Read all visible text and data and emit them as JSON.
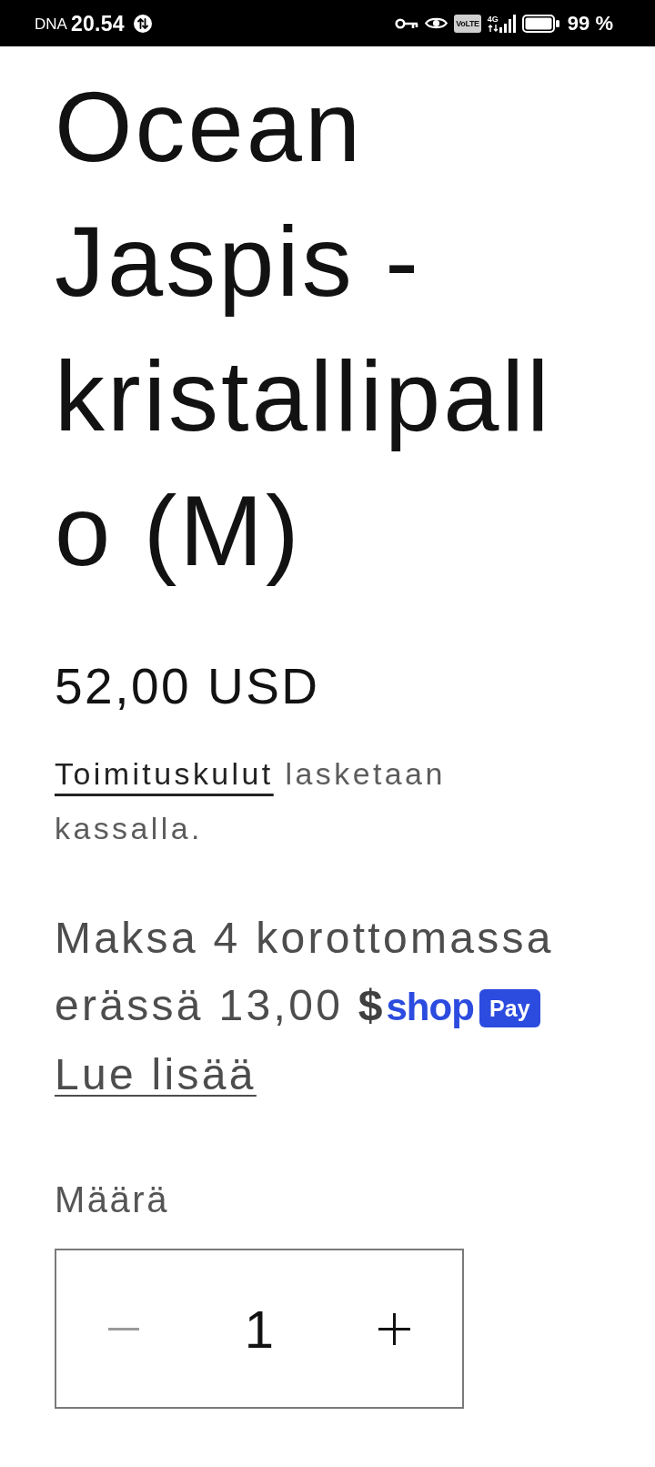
{
  "status_bar": {
    "carrier": "DNA",
    "time": "20.54",
    "volte": "VoLTE",
    "network": "4G",
    "battery": "99 %"
  },
  "product": {
    "title": "Ocean Jaspis - kristallipallo (M)",
    "price": "52,00 USD"
  },
  "shipping_note": {
    "link": "Toimituskulut",
    "text": "lasketaan kassalla."
  },
  "installments": {
    "text": "Maksa 4 korottomassa erässä 13,00 **$**",
    "logo": {
      "wordmark": "shop",
      "badge": "Pay"
    },
    "link": "Lue lisää"
  },
  "quantity": {
    "label": "Määrä",
    "value": "1",
    "decrease": {
      "disabled": true
    },
    "increase": {
      "disabled": false
    }
  }
}
